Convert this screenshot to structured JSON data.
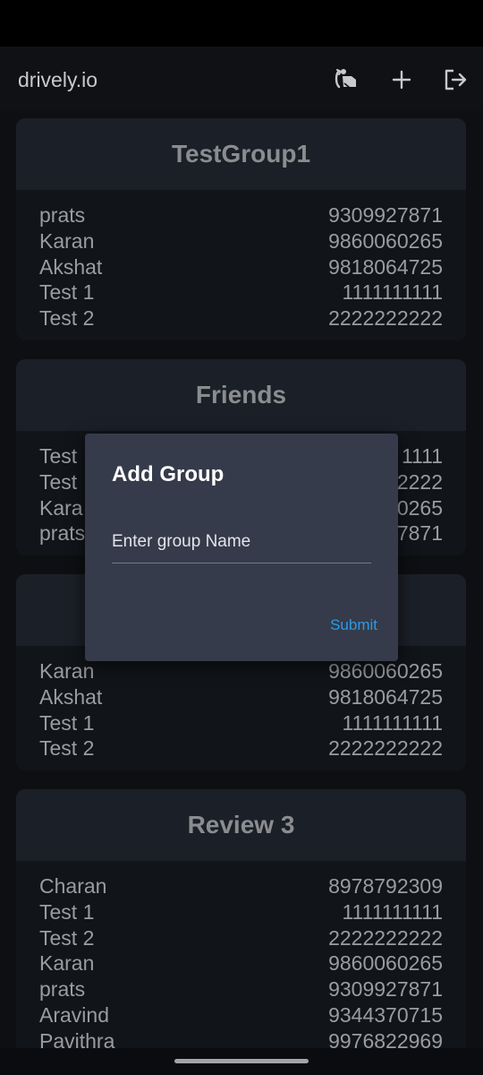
{
  "app": {
    "brand": "drively.io"
  },
  "toolbar": {
    "icons": [
      "steering-wheel-icon",
      "add-icon",
      "logout-icon"
    ]
  },
  "groups": [
    {
      "name": "TestGroup1",
      "members": [
        {
          "name": "prats",
          "phone": "9309927871"
        },
        {
          "name": "Karan",
          "phone": "9860060265"
        },
        {
          "name": "Akshat",
          "phone": "9818064725"
        },
        {
          "name": "Test 1",
          "phone": "1111111111"
        },
        {
          "name": "Test 2",
          "phone": "2222222222"
        }
      ]
    },
    {
      "name": "Friends",
      "members": [
        {
          "name": "Test",
          "phone": "1111"
        },
        {
          "name": "Test",
          "phone": "2222"
        },
        {
          "name": "Kara",
          "phone": "0265"
        },
        {
          "name": "prats",
          "phone": "7871"
        }
      ]
    },
    {
      "name": "",
      "members": [
        {
          "name": "Karan",
          "phone": "9860060265"
        },
        {
          "name": "Akshat",
          "phone": "9818064725"
        },
        {
          "name": "Test 1",
          "phone": "1111111111"
        },
        {
          "name": "Test 2",
          "phone": "2222222222"
        }
      ]
    },
    {
      "name": "Review 3",
      "members": [
        {
          "name": "Charan",
          "phone": "8978792309"
        },
        {
          "name": "Test 1",
          "phone": "1111111111"
        },
        {
          "name": "Test 2",
          "phone": "2222222222"
        },
        {
          "name": "Karan",
          "phone": "9860060265"
        },
        {
          "name": "prats",
          "phone": "9309927871"
        },
        {
          "name": "Aravind",
          "phone": "9344370715"
        },
        {
          "name": "Pavithra",
          "phone": "9976822969"
        }
      ]
    }
  ],
  "dialog": {
    "title": "Add Group",
    "input_placeholder": "Enter group Name",
    "input_value": "",
    "submit_label": "Submit"
  },
  "colors": {
    "accent": "#2c9ae8",
    "card_header": "#1b1f27",
    "dialog_bg": "#353b4a"
  }
}
